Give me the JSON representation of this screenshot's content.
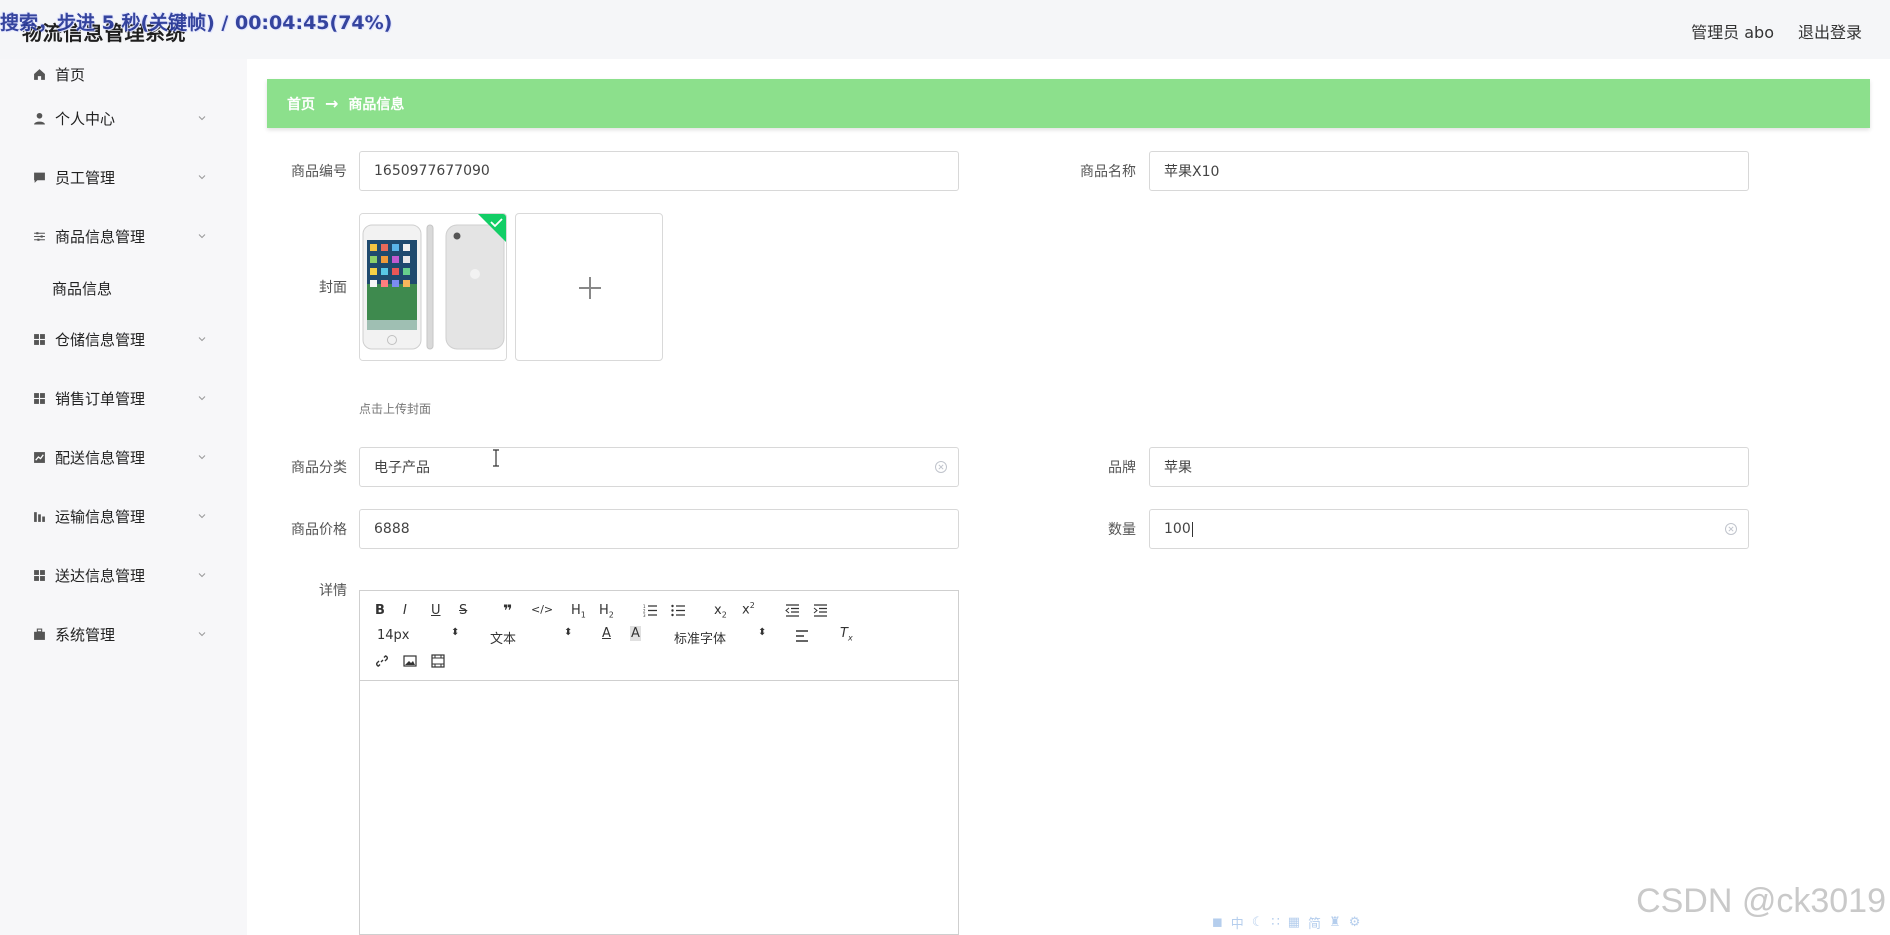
{
  "header": {
    "app_title": "物流信息管理系统",
    "overlay_text": "搜索，步进 5 秒(关键帧) / 00:04:45(74%)",
    "user_label": "管理员 abo",
    "logout_label": "退出登录"
  },
  "sidebar": {
    "items": [
      {
        "label": "首页",
        "icon": "home-icon"
      },
      {
        "label": "个人中心",
        "icon": "user-icon"
      },
      {
        "label": "员工管理",
        "icon": "chat-icon"
      },
      {
        "label": "商品信息管理",
        "icon": "sliders-icon"
      },
      {
        "label": "商品信息"
      },
      {
        "label": "仓储信息管理",
        "icon": "grid-icon"
      },
      {
        "label": "销售订单管理",
        "icon": "grid-icon"
      },
      {
        "label": "配送信息管理",
        "icon": "chart-icon"
      },
      {
        "label": "运输信息管理",
        "icon": "bar-chart-icon"
      },
      {
        "label": "送达信息管理",
        "icon": "grid-icon"
      },
      {
        "label": "系统管理",
        "icon": "briefcase-icon"
      }
    ]
  },
  "breadcrumb": {
    "home": "首页",
    "separator": "→",
    "current": "商品信息"
  },
  "form": {
    "product_no": {
      "label": "商品编号",
      "value": "1650977677090"
    },
    "product_name": {
      "label": "商品名称",
      "value": "苹果X10"
    },
    "cover": {
      "label": "封面",
      "hint": "点击上传封面"
    },
    "category": {
      "label": "商品分类",
      "value": "电子产品"
    },
    "brand": {
      "label": "品牌",
      "value": "苹果"
    },
    "price": {
      "label": "商品价格",
      "value": "6888"
    },
    "quantity": {
      "label": "数量",
      "value": "100"
    },
    "detail": {
      "label": "详情"
    }
  },
  "editor": {
    "font_size": "14px",
    "paragraph": "文本",
    "font_family": "标准字体"
  },
  "watermark": "CSDN @ck3019",
  "colors": {
    "accent_green": "#8ce08c",
    "success_badge": "#13ce66"
  }
}
